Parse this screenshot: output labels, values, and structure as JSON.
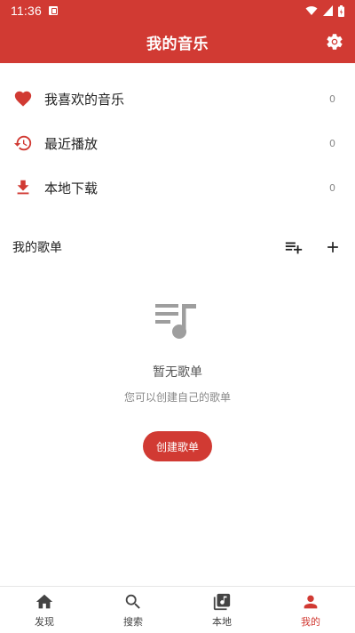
{
  "status_bar": {
    "time": "11:36"
  },
  "header": {
    "title": "我的音乐"
  },
  "menu": [
    {
      "label": "我喜欢的音乐",
      "count": "0",
      "icon": "heart-icon"
    },
    {
      "label": "最近播放",
      "count": "0",
      "icon": "history-icon"
    },
    {
      "label": "本地下载",
      "count": "0",
      "icon": "download-icon"
    }
  ],
  "playlists": {
    "title": "我的歌单",
    "empty_title": "暂无歌单",
    "empty_subtitle": "您可以创建自己的歌单",
    "create_label": "创建歌单"
  },
  "bottom_nav": [
    {
      "label": "发现",
      "icon": "home-icon"
    },
    {
      "label": "搜索",
      "icon": "search-icon"
    },
    {
      "label": "本地",
      "icon": "library-icon"
    },
    {
      "label": "我的",
      "icon": "person-icon",
      "active": true
    }
  ],
  "colors": {
    "accent": "#d13a33",
    "muted": "#888888"
  }
}
